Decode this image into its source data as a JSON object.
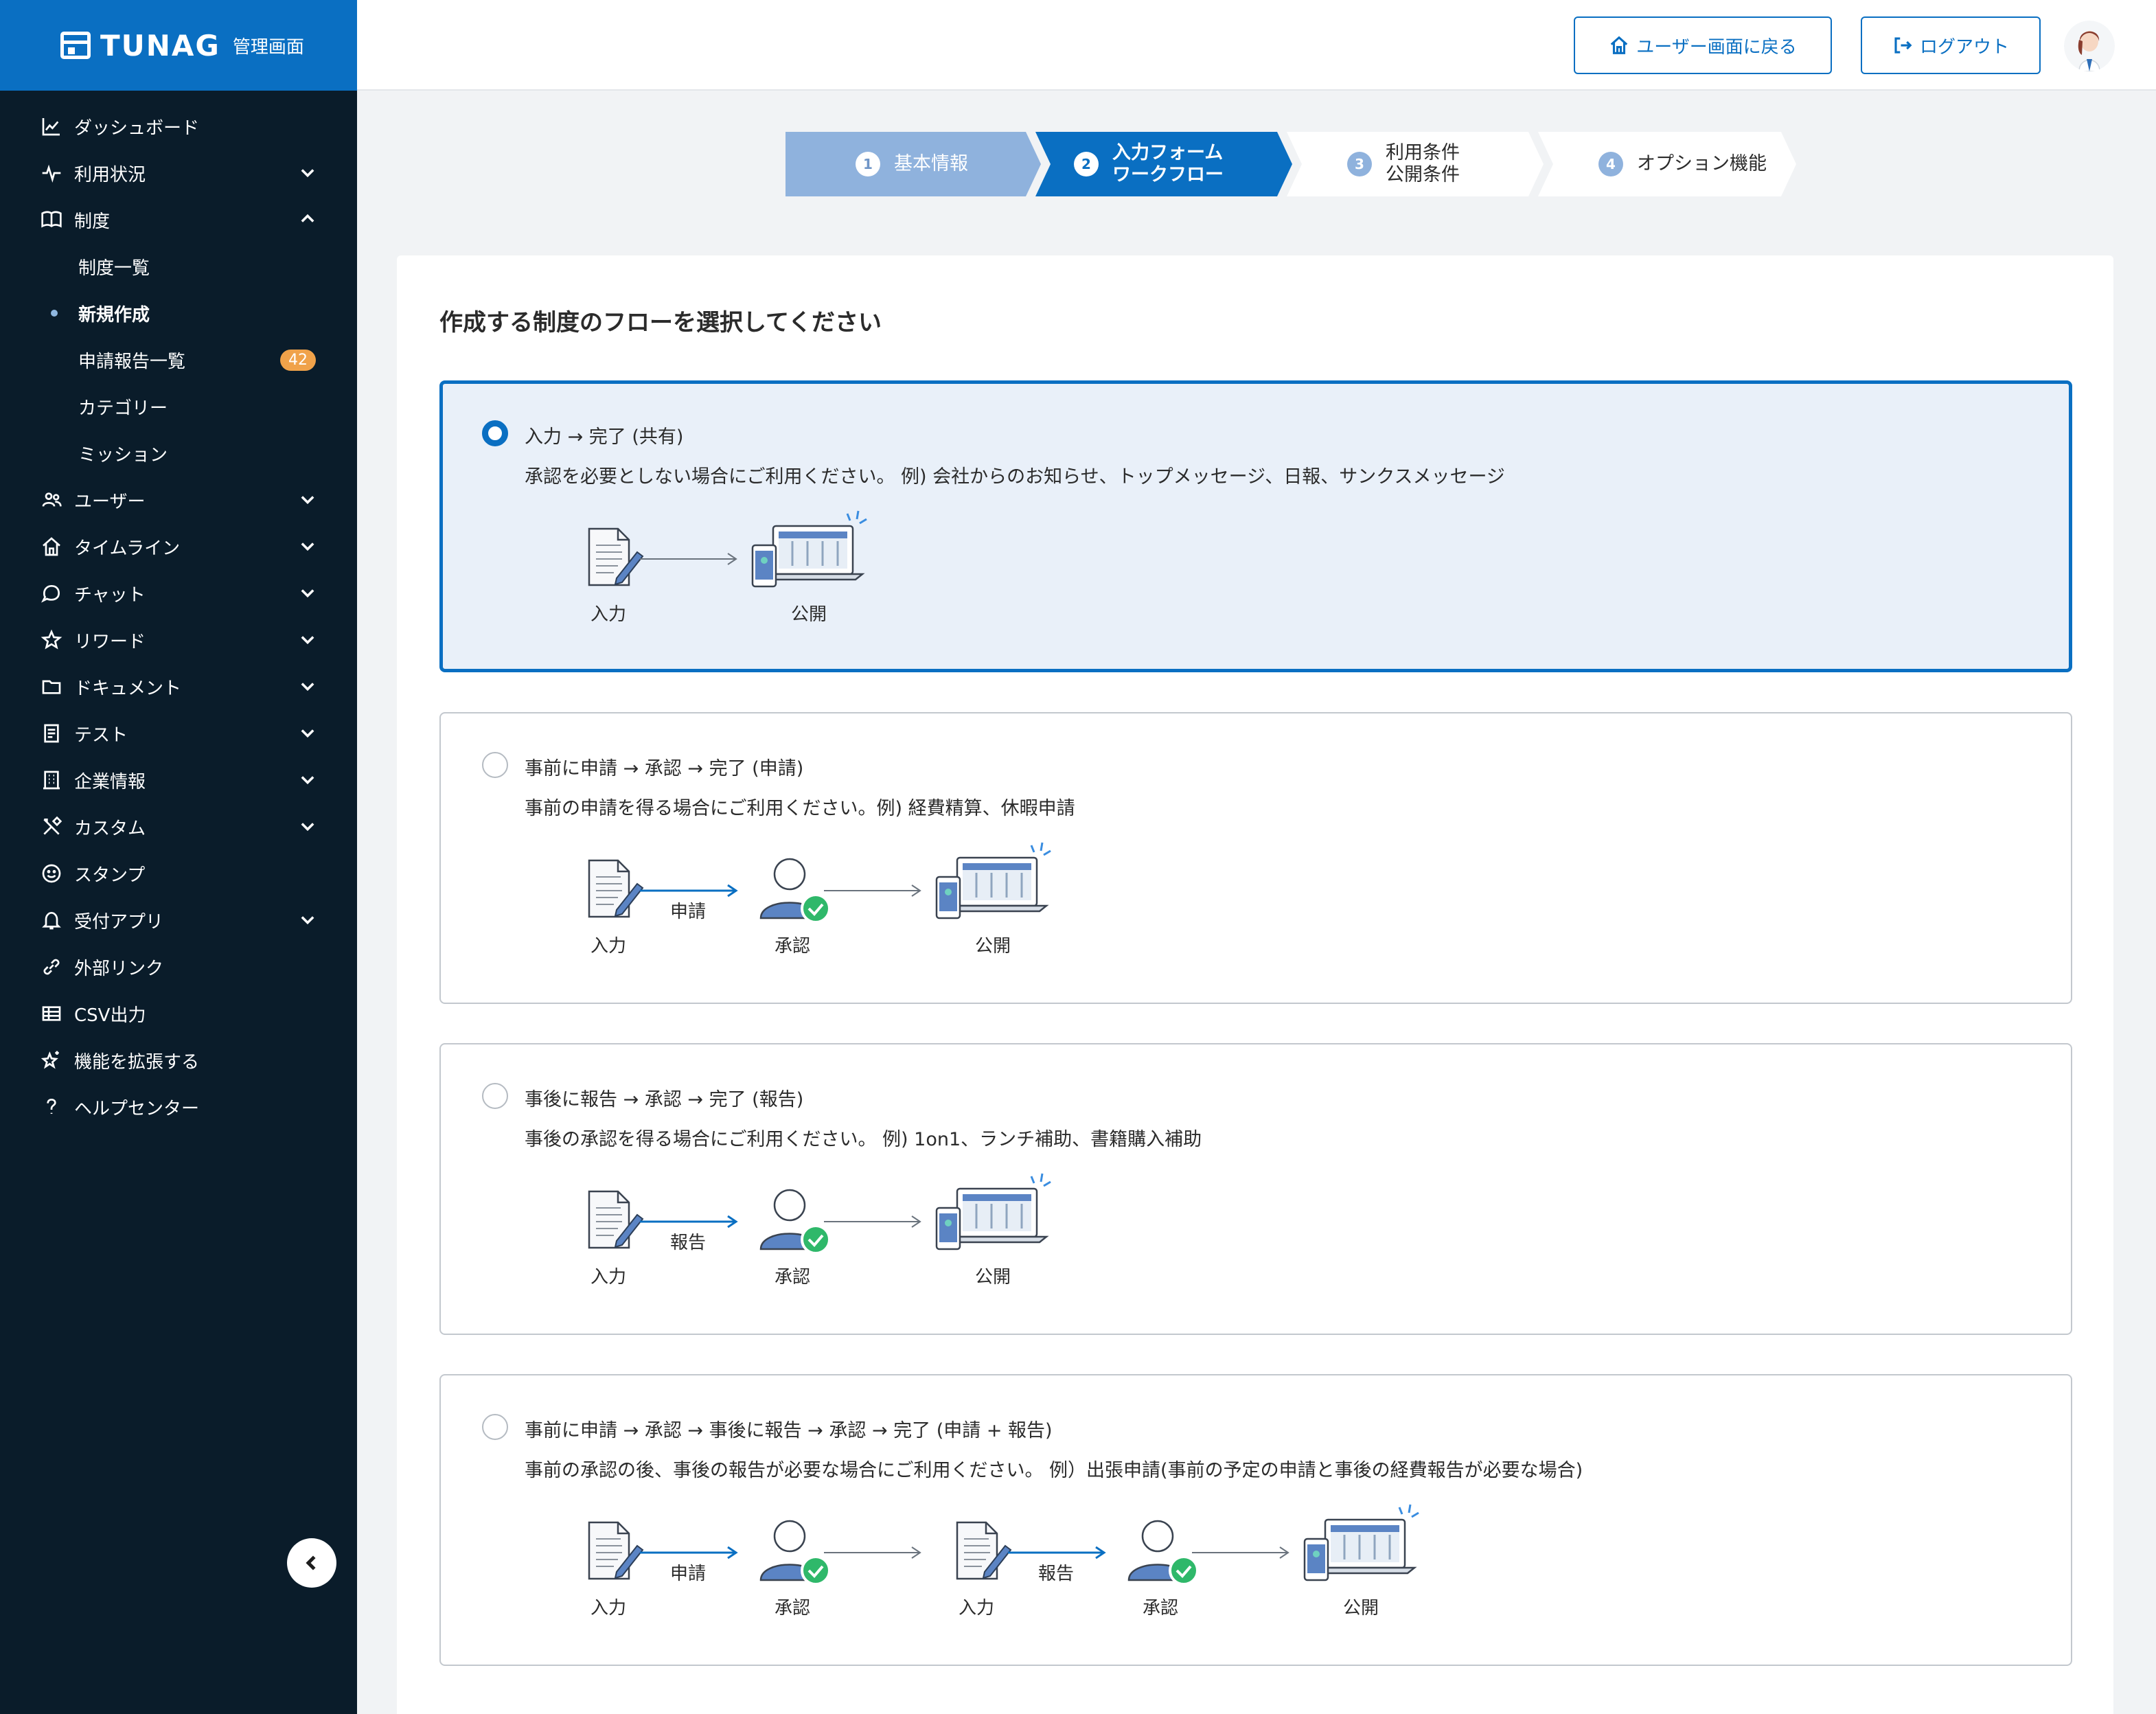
{
  "brand": {
    "name": "TUNAG",
    "sub": "管理画面"
  },
  "sidebar": {
    "items": [
      {
        "label": "ダッシュボード",
        "icon": "chart-line-icon",
        "chevron": ""
      },
      {
        "label": "利用状況",
        "icon": "pulse-icon",
        "chevron": "down"
      },
      {
        "label": "制度",
        "icon": "book-icon",
        "chevron": "up"
      },
      {
        "label": "ユーザー",
        "icon": "users-icon",
        "chevron": "down"
      },
      {
        "label": "タイムライン",
        "icon": "home-icon",
        "chevron": "down"
      },
      {
        "label": "チャット",
        "icon": "chat-icon",
        "chevron": "down"
      },
      {
        "label": "リワード",
        "icon": "star-icon",
        "chevron": "down"
      },
      {
        "label": "ドキュメント",
        "icon": "folder-icon",
        "chevron": "down"
      },
      {
        "label": "テスト",
        "icon": "checklist-icon",
        "chevron": "down"
      },
      {
        "label": "企業情報",
        "icon": "building-icon",
        "chevron": "down"
      },
      {
        "label": "カスタム",
        "icon": "tools-icon",
        "chevron": "down"
      },
      {
        "label": "スタンプ",
        "icon": "smile-icon",
        "chevron": ""
      },
      {
        "label": "受付アプリ",
        "icon": "bell-icon",
        "chevron": "down"
      },
      {
        "label": "外部リンク",
        "icon": "link-icon",
        "chevron": ""
      },
      {
        "label": "CSV出力",
        "icon": "table-icon",
        "chevron": ""
      },
      {
        "label": "機能を拡張する",
        "icon": "sparkle-star-icon",
        "chevron": ""
      },
      {
        "label": "ヘルプセンター",
        "icon": "question-icon",
        "chevron": ""
      }
    ],
    "subitems": [
      {
        "label": "制度一覧"
      },
      {
        "label": "新規作成"
      },
      {
        "label": "申請報告一覧",
        "badge": "42"
      },
      {
        "label": "カテゴリー"
      },
      {
        "label": "ミッション"
      }
    ]
  },
  "header": {
    "back_label": "ユーザー画面に戻る",
    "logout_label": "ログアウト"
  },
  "steps": [
    {
      "num": "1",
      "label": "基本情報",
      "state": "done"
    },
    {
      "num": "2",
      "label": "入力フォーム\nワークフロー",
      "state": "current"
    },
    {
      "num": "3",
      "label": "利用条件\n公開条件",
      "state": "todo"
    },
    {
      "num": "4",
      "label": "オプション機能",
      "state": "todo"
    }
  ],
  "main": {
    "title": "作成する制度のフローを選択してください",
    "options": [
      {
        "head": "入力 → 完了 (共有)",
        "desc": "承認を必要としない場合にご利用ください。 例) 会社からのお知らせ、トップメッセージ、日報、サンクスメッセージ",
        "selected": true,
        "flow": [
          {
            "kind": "input",
            "label": "入力"
          },
          {
            "kind": "arrow",
            "label": ""
          },
          {
            "kind": "publish",
            "label": "公開"
          }
        ]
      },
      {
        "head": "事前に申請 → 承認 → 完了 (申請)",
        "desc": "事前の申請を得る場合にご利用ください。例) 経費精算、休暇申請",
        "selected": false,
        "flow": [
          {
            "kind": "input",
            "label": "入力"
          },
          {
            "kind": "arrow-blue",
            "label": "申請"
          },
          {
            "kind": "approve",
            "label": "承認"
          },
          {
            "kind": "arrow",
            "label": ""
          },
          {
            "kind": "publish",
            "label": "公開"
          }
        ]
      },
      {
        "head": "事後に報告 → 承認 → 完了 (報告)",
        "desc": "事後の承認を得る場合にご利用ください。 例) 1on1、ランチ補助、書籍購入補助",
        "selected": false,
        "flow": [
          {
            "kind": "input",
            "label": "入力"
          },
          {
            "kind": "arrow-blue",
            "label": "報告"
          },
          {
            "kind": "approve",
            "label": "承認"
          },
          {
            "kind": "arrow",
            "label": ""
          },
          {
            "kind": "publish",
            "label": "公開"
          }
        ]
      },
      {
        "head": "事前に申請 → 承認 → 事後に報告 → 承認 → 完了 (申請 + 報告)",
        "desc": "事前の承認の後、事後の報告が必要な場合にご利用ください。 例）出張申請(事前の予定の申請と事後の経費報告が必要な場合)",
        "selected": false,
        "flow": [
          {
            "kind": "input",
            "label": "入力"
          },
          {
            "kind": "arrow-blue",
            "label": "申請"
          },
          {
            "kind": "approve",
            "label": "承認"
          },
          {
            "kind": "arrow",
            "label": ""
          },
          {
            "kind": "input",
            "label": "入力"
          },
          {
            "kind": "arrow-blue",
            "label": "報告"
          },
          {
            "kind": "approve",
            "label": "承認"
          },
          {
            "kind": "arrow",
            "label": ""
          },
          {
            "kind": "publish",
            "label": "公開"
          }
        ]
      }
    ]
  },
  "colors": {
    "brand": "#0a6fc2",
    "sidebar_bg": "#0a1c2a",
    "selected_bg": "#e9f0f9",
    "badge": "#f0a24a",
    "step_done": "#8fb2dd",
    "approve_check": "#2fb86a"
  }
}
